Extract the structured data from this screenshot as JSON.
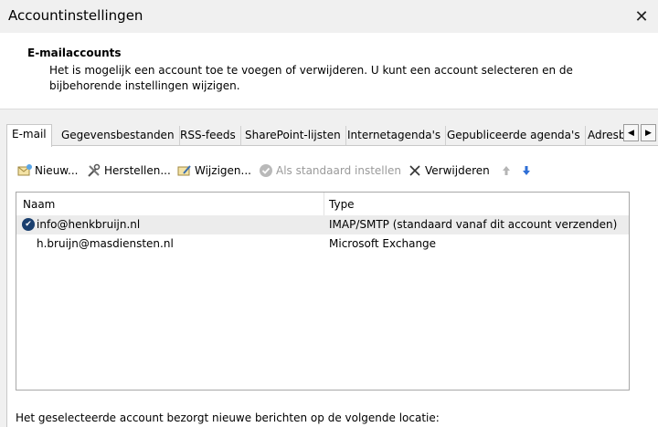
{
  "window": {
    "title": "Accountinstellingen"
  },
  "header": {
    "title": "E-mailaccounts",
    "description": "Het is mogelijk een account toe te voegen of verwijderen. U kunt een account selecteren en de bijbehorende instellingen wijzigen."
  },
  "tabs": [
    {
      "label": "E-mail",
      "active": true
    },
    {
      "label": "Gegevensbestanden"
    },
    {
      "label": "RSS-feeds"
    },
    {
      "label": "SharePoint-lijsten"
    },
    {
      "label": "Internetagenda's"
    },
    {
      "label": "Gepubliceerde agenda's"
    },
    {
      "label": "Adresb"
    }
  ],
  "toolbar": {
    "new_label": "Nieuw...",
    "repair_label": "Herstellen...",
    "change_label": "Wijzigen...",
    "set_default_label": "Als standaard instellen",
    "remove_label": "Verwijderen"
  },
  "list": {
    "col_name": "Naam",
    "col_type": "Type",
    "rows": [
      {
        "name": "info@henkbruijn.nl",
        "type": "IMAP/SMTP (standaard vanaf dit account verzenden)",
        "default": true
      },
      {
        "name": "h.bruijn@masdiensten.nl",
        "type": "Microsoft Exchange"
      }
    ]
  },
  "footer": {
    "text": "Het geselecteerde account bezorgt nieuwe berichten op de volgende locatie:"
  },
  "colors": {
    "accent": "#1a3f6e",
    "arrow_down": "#2f6fd6"
  }
}
